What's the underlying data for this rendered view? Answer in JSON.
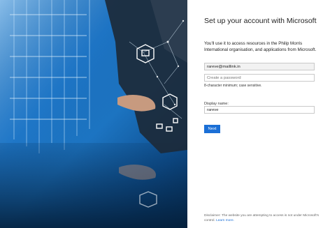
{
  "title": "Set up your account with Microsoft",
  "lead": "You'll use it to access resources in the Philip Morris International organisation, and applications from Microsoft.",
  "email": {
    "value": "rareve@maillink.in"
  },
  "password": {
    "placeholder": "Create a password",
    "hint": "8-character minimum; case sensitive."
  },
  "display_name": {
    "label": "Display name:",
    "value": "rareve"
  },
  "next_label": "Next",
  "disclaimer": {
    "text": "Disclaimer: The website you are attempting to access is not under Microsoft's control.",
    "link": "Learn more."
  },
  "colors": {
    "accent": "#1b6fd6",
    "hero_blue": "#1b77c7"
  }
}
